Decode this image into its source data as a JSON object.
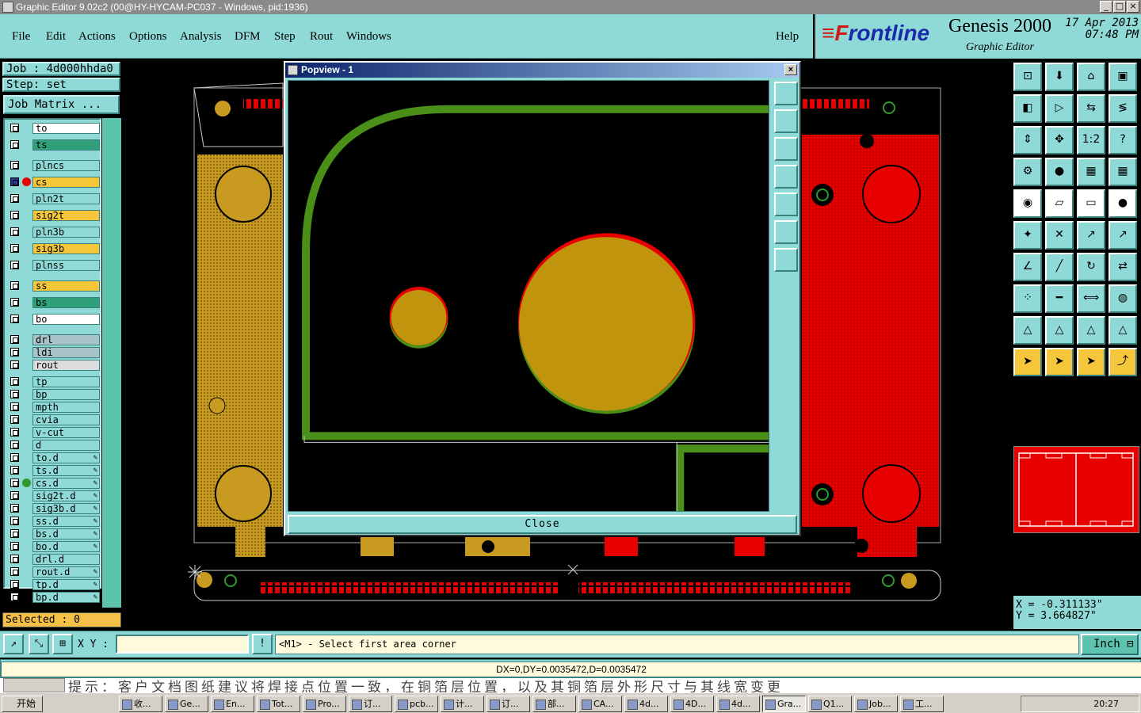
{
  "window": {
    "title": "Graphic Editor 9.02c2 (00@HY-HYCAM-PC037 - Windows, pid:1936)",
    "btn_min": "_",
    "btn_max": "□",
    "btn_close": "×"
  },
  "menu": {
    "items": [
      "File",
      "Edit",
      "Actions",
      "Options",
      "Analysis",
      "DFM",
      "Step",
      "Rout",
      "Windows"
    ],
    "help": "Help"
  },
  "brand": {
    "logo_mark": "≡F",
    "logo_text": "rontline",
    "product": "Genesis 2000",
    "subtitle": "Graphic Editor",
    "date": "17 Apr 2013",
    "time": "07:48 PM"
  },
  "job": {
    "job_label": "Job : 4d000hhda0",
    "step_label": "Step: set",
    "matrix_button": "Job Matrix ..."
  },
  "layers": [
    {
      "name": "to",
      "color": "#ffffff"
    },
    {
      "name": "ts",
      "color": "#2fa07a"
    },
    {
      "name": "plncs",
      "color": "#8fdad6"
    },
    {
      "name": "cs",
      "color": "#f6c63a",
      "active": true,
      "dot": "#e80000"
    },
    {
      "name": "pln2t",
      "color": "#8fdad6"
    },
    {
      "name": "sig2t",
      "color": "#f6c63a"
    },
    {
      "name": "pln3b",
      "color": "#8fdad6"
    },
    {
      "name": "sig3b",
      "color": "#f6c63a"
    },
    {
      "name": "plnss",
      "color": "#8fdad6"
    },
    {
      "name": "ss",
      "color": "#f6c63a"
    },
    {
      "name": "bs",
      "color": "#2fa07a"
    },
    {
      "name": "bo",
      "color": "#ffffff"
    },
    {
      "name": "drl",
      "color": "#a8c4c8"
    },
    {
      "name": "ldi",
      "color": "#a8c4c8"
    },
    {
      "name": "rout",
      "color": "#dcdcdc"
    },
    {
      "name": "tp",
      "color": "#8fdad6"
    },
    {
      "name": "bp",
      "color": "#8fdad6"
    },
    {
      "name": "mpth",
      "color": "#8fdad6"
    },
    {
      "name": "cvia",
      "color": "#8fdad6"
    },
    {
      "name": "v-cut",
      "color": "#8fdad6"
    },
    {
      "name": "d",
      "color": "#8fdad6"
    },
    {
      "name": "to.d",
      "color": "#8fdad6",
      "pen": true
    },
    {
      "name": "ts.d",
      "color": "#8fdad6",
      "pen": true
    },
    {
      "name": "cs.d",
      "color": "#8fdad6",
      "pen": true,
      "dot": "#2e9a2e"
    },
    {
      "name": "sig2t.d",
      "color": "#8fdad6",
      "pen": true
    },
    {
      "name": "sig3b.d",
      "color": "#8fdad6",
      "pen": true
    },
    {
      "name": "ss.d",
      "color": "#8fdad6",
      "pen": true
    },
    {
      "name": "bs.d",
      "color": "#8fdad6",
      "pen": true
    },
    {
      "name": "bo.d",
      "color": "#8fdad6",
      "pen": true
    },
    {
      "name": "drl.d",
      "color": "#8fdad6"
    },
    {
      "name": "rout.d",
      "color": "#8fdad6",
      "pen": true
    },
    {
      "name": "tp.d",
      "color": "#8fdad6",
      "pen": true
    },
    {
      "name": "bp.d",
      "color": "#8fdad6",
      "pen": true
    }
  ],
  "selected": "Selected : 0",
  "popview": {
    "title": "Popview - 1",
    "close_label": "Close"
  },
  "coords": {
    "x": "X  =  -0.311133\"",
    "y": "Y  =  3.664827\""
  },
  "cmd": {
    "xy_label": "X Y :",
    "xy_value": "",
    "prompt": "<M1> - Select first area corner",
    "unit": "Inch"
  },
  "status": "DX=0,DY=0.0035472,D=0.0035472",
  "ime_bg_text": "提示：客户文档图纸建议将焊接点位置一致，在铜箔层位置，以及其铜箔层外形尺寸与其线宽变更",
  "taskbar": {
    "start": "开始",
    "tasks": [
      "收...",
      "Ge...",
      "En...",
      "Tot...",
      "Pro...",
      "订...",
      "pcb...",
      "计...",
      "订...",
      "部...",
      "CA...",
      "4d...",
      "4D...",
      "4d...",
      "Gra...",
      "Q1...",
      "Job...",
      "工..."
    ],
    "active_index": 14,
    "clock": "20:27"
  }
}
